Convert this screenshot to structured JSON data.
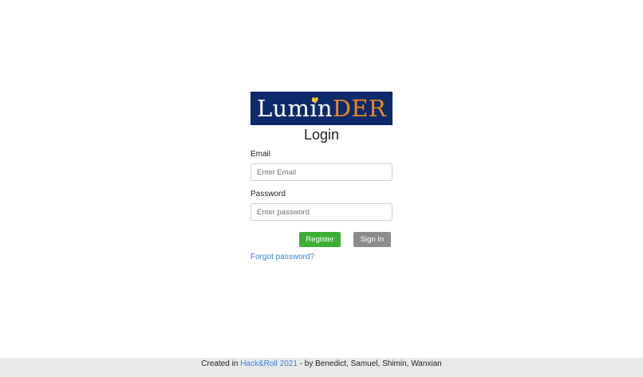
{
  "logo": {
    "part_a": "Lumin",
    "part_b": "DER",
    "heart": "♥"
  },
  "login": {
    "title": "Login",
    "email_label": "Email",
    "email_placeholder": "Enter Email",
    "email_value": "",
    "password_label": "Password",
    "password_placeholder": "Enter password",
    "password_value": "",
    "register_label": "Register",
    "signin_label": "Sign In",
    "forgot_label": "Forgot password?"
  },
  "footer": {
    "prefix": "Created in ",
    "link": "Hack&Roll 2021",
    "suffix": " - by Benedict, Samuel, Shimin, Wanxian"
  },
  "colors": {
    "logo_bg": "#0f2a6b",
    "logo_accent": "#e88a1a",
    "heart": "#f6c22c",
    "register": "#3cb034",
    "signin": "#8c8c8c",
    "link": "#3b82d6",
    "footer_bg": "#e9e9e9"
  }
}
